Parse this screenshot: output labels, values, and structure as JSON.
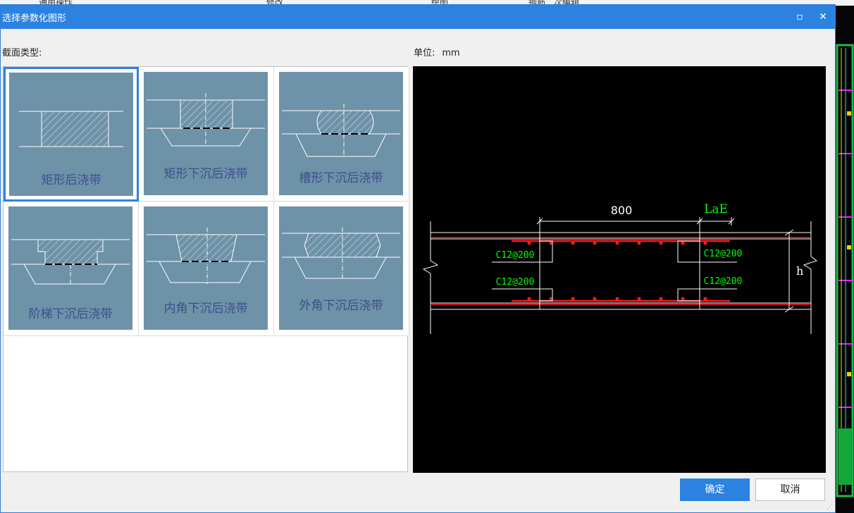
{
  "background": {
    "menu_segments": [
      "通用操作",
      "修改",
      "绘图",
      "钢筋二次编辑"
    ]
  },
  "dialog": {
    "title": "选择参数化图形",
    "restore_glyph": "▫",
    "close_glyph": "✕",
    "section_label": "截面类型:",
    "unit_label": "单位:",
    "unit_value": "mm",
    "shapes": [
      {
        "label": "矩形后浇带",
        "selected": true
      },
      {
        "label": "矩形下沉后浇带",
        "selected": false
      },
      {
        "label": "槽形下沉后浇带",
        "selected": false
      },
      {
        "label": "阶梯下沉后浇带",
        "selected": false
      },
      {
        "label": "内角下沉后浇带",
        "selected": false
      },
      {
        "label": "外角下沉后浇带",
        "selected": false
      }
    ],
    "preview": {
      "dimension_width": "800",
      "dimension_lae": "LaE",
      "rebar_top_left": "C12@200",
      "rebar_bottom_left": "C12@200",
      "rebar_top_right": "C12@200",
      "rebar_bottom_right": "C12@200",
      "height_label": "h",
      "colors": {
        "rebar": "#ff1a1a",
        "text": "#00ff00",
        "lines": "#ffffff"
      }
    },
    "ok_label": "确定",
    "cancel_label": "取消"
  }
}
